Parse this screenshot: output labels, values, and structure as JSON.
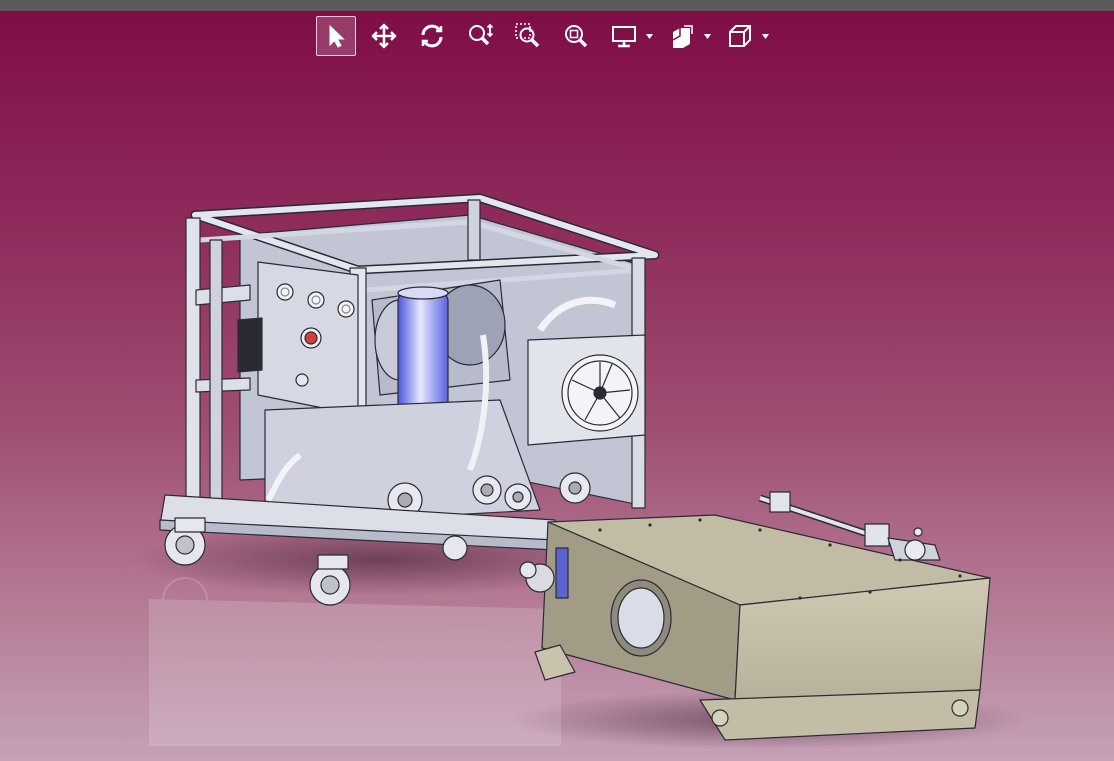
{
  "toolbar": {
    "items": [
      {
        "icon": "select-arrow-icon",
        "active": true
      },
      {
        "icon": "pan-icon",
        "active": false
      },
      {
        "icon": "rotate-icon",
        "active": false
      },
      {
        "icon": "zoom-in-out-icon",
        "active": false
      },
      {
        "icon": "zoom-window-icon",
        "active": false
      },
      {
        "icon": "zoom-fit-icon",
        "active": false
      },
      {
        "icon": "display-mode-icon",
        "dropdown": true
      },
      {
        "icon": "section-view-icon",
        "dropdown": true
      },
      {
        "icon": "standard-views-icon",
        "dropdown": true
      }
    ]
  },
  "viewport": {
    "model": "hydraulic-power-unit-assembly",
    "background_top": "#7e0c45",
    "background_bottom": "#c6a2b6",
    "frame_color": "#dfe1ea",
    "tank_color": "#c9c3ad",
    "filter_color": "#6f78ee"
  }
}
